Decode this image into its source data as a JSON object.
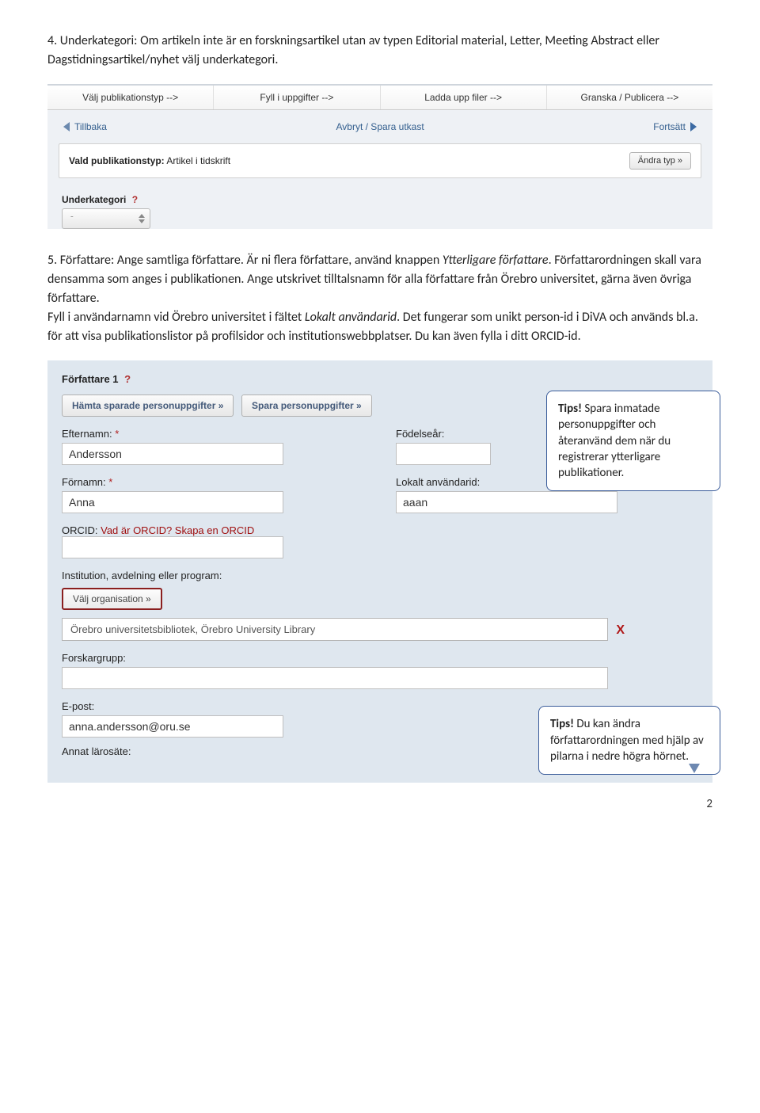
{
  "section4": {
    "num": "4.",
    "title": "Underkategori:",
    "body": "Om artikeln inte är en forskningsartikel utan av typen Editorial material, Letter, Meeting Abstract eller Dagstidningsartikel/nyhet välj underkategori."
  },
  "wizard": {
    "steps": [
      "Välj publikationstyp -->",
      "Fyll i uppgifter -->",
      "Ladda upp filer -->",
      "Granska / Publicera -->"
    ],
    "back": "Tillbaka",
    "cancel": "Avbryt / Spara utkast",
    "continue": "Fortsätt",
    "chosen_label": "Vald publikationstyp:",
    "chosen_value": "Artikel i tidskrift",
    "change_type": "Ändra typ »",
    "subcat_label": "Underkategori",
    "subcat_selected": "-"
  },
  "section5": {
    "num": "5.",
    "title": "Författare:",
    "p1a": "Ange samtliga författare. Är ni flera författare, använd knappen ",
    "p1b_italic": "Ytterligare författare",
    "p1c": ". Författarordningen skall vara densamma som anges i publikationen. Ange utskrivet tilltalsnamn för alla författare från Örebro universitet, gärna även övriga författare.",
    "p2a": "Fyll i användarnamn vid Örebro universitet i fältet ",
    "p2b_italic": "Lokalt användarid",
    "p2c": ". Det fungerar som unikt person-id i DiVA och används bl.a. för att visa publikationslistor på profilsidor och institutionswebbplatser. Du kan även fylla i ditt ORCID-id."
  },
  "author": {
    "header": "Författare 1",
    "btn_load": "Hämta sparade personuppgifter »",
    "btn_save": "Spara personuppgifter »",
    "lastname_label": "Efternamn:",
    "lastname_value": "Andersson",
    "birthyear_label": "Födelseår:",
    "birthyear_value": "",
    "firstname_label": "Förnamn:",
    "firstname_value": "Anna",
    "localid_label": "Lokalt användarid:",
    "localid_value": "aaan",
    "orcid_label": "ORCID:",
    "orcid_link": "Vad är ORCID? Skapa en ORCID",
    "orcid_value": "",
    "inst_label": "Institution, avdelning eller program:",
    "org_btn": "Välj organisation »",
    "org_value": "Örebro universitetsbibliotek, Örebro University Library",
    "group_label": "Forskargrupp:",
    "group_value": "",
    "email_label": "E-post:",
    "email_value": "anna.andersson@oru.se",
    "otheruni_label": "Annat lärosäte:"
  },
  "tips": {
    "tip1_b": "Tips!",
    "tip1": " Spara inmatade personuppgifter och återanvänd dem när du registrerar ytterligare publikationer.",
    "tip2_b": "Tips!",
    "tip2": " Du kan ändra författarordningen med hjälp av pilarna i nedre högra hörnet."
  },
  "page_num": "2"
}
